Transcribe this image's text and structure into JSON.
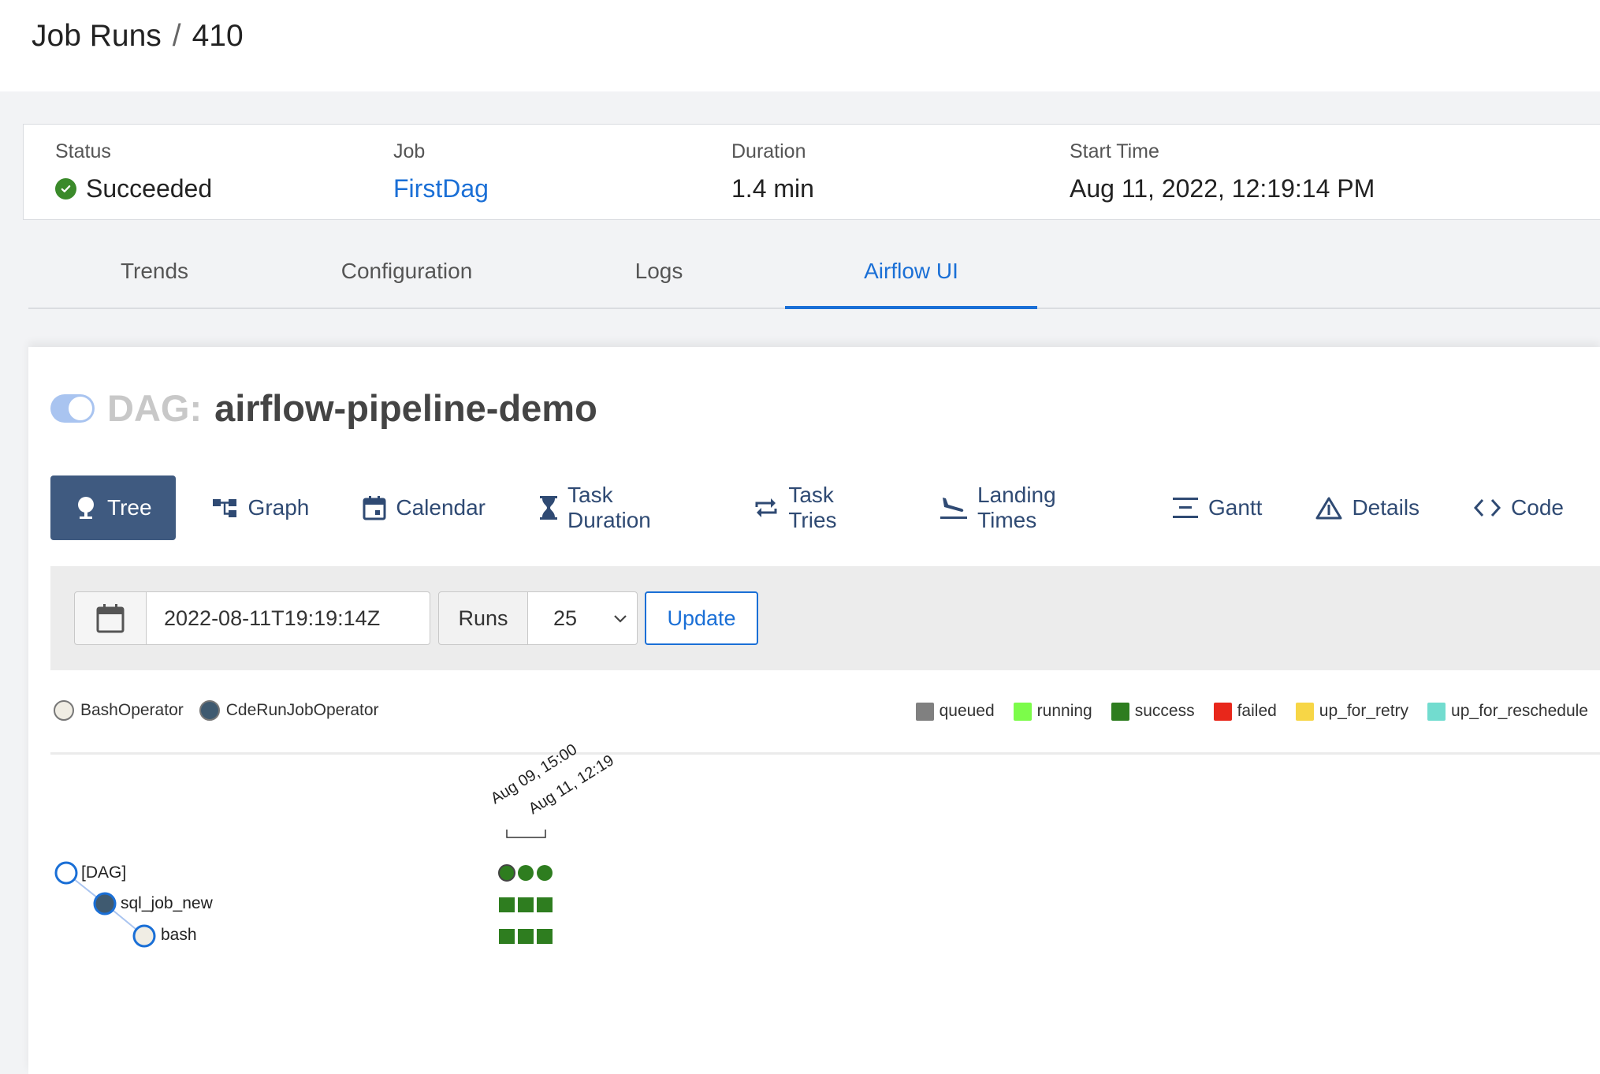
{
  "breadcrumb": {
    "root": "Job Runs",
    "separator": "/",
    "current": "410"
  },
  "summary": {
    "status_label": "Status",
    "status_value": "Succeeded",
    "job_label": "Job",
    "job_value": "FirstDag",
    "duration_label": "Duration",
    "duration_value": "1.4 min",
    "start_label": "Start Time",
    "start_value": "Aug 11, 2022, 12:19:14 PM"
  },
  "tabs": [
    {
      "label": "Trends",
      "active": false
    },
    {
      "label": "Configuration",
      "active": false
    },
    {
      "label": "Logs",
      "active": false
    },
    {
      "label": "Airflow UI",
      "active": true
    }
  ],
  "dag": {
    "prefix": "DAG:",
    "name": "airflow-pipeline-demo",
    "paused": false
  },
  "views": [
    {
      "label": "Tree",
      "icon": "tree-icon",
      "active": true
    },
    {
      "label": "Graph",
      "icon": "graph-icon"
    },
    {
      "label": "Calendar",
      "icon": "calendar-icon"
    },
    {
      "label": "Task Duration",
      "icon": "hourglass-icon"
    },
    {
      "label": "Task Tries",
      "icon": "repeat-icon"
    },
    {
      "label": "Landing Times",
      "icon": "plane-landing-icon"
    },
    {
      "label": "Gantt",
      "icon": "gantt-icon"
    },
    {
      "label": "Details",
      "icon": "warning-triangle-icon"
    },
    {
      "label": "Code",
      "icon": "code-icon"
    }
  ],
  "controls": {
    "base_date": "2022-08-11T19:19:14Z",
    "runs_label": "Runs",
    "runs_value": "25",
    "update_label": "Update"
  },
  "operators": [
    {
      "name": "BashOperator",
      "color": "#f0ede4"
    },
    {
      "name": "CdeRunJobOperator",
      "color": "#3f5a70"
    }
  ],
  "states": [
    {
      "name": "queued",
      "color": "#808080"
    },
    {
      "name": "running",
      "color": "#7cfc4a"
    },
    {
      "name": "success",
      "color": "#2e7d1f"
    },
    {
      "name": "failed",
      "color": "#e8271b"
    },
    {
      "name": "up_for_retry",
      "color": "#f7d646"
    },
    {
      "name": "up_for_reschedule",
      "color": "#72dccf"
    }
  ],
  "tree": {
    "run_dates": [
      "Aug 09, 15:00",
      "Aug 11, 12:19"
    ],
    "nodes": [
      {
        "label": "[DAG]",
        "fill": "#ffffff",
        "runs": [
          "success",
          "success",
          "success"
        ]
      },
      {
        "label": "sql_job_new",
        "fill": "#3f5a70",
        "runs": [
          "success",
          "success",
          "success"
        ]
      },
      {
        "label": "bash",
        "fill": "#f0ede4",
        "runs": [
          "success",
          "success",
          "success"
        ]
      }
    ]
  }
}
